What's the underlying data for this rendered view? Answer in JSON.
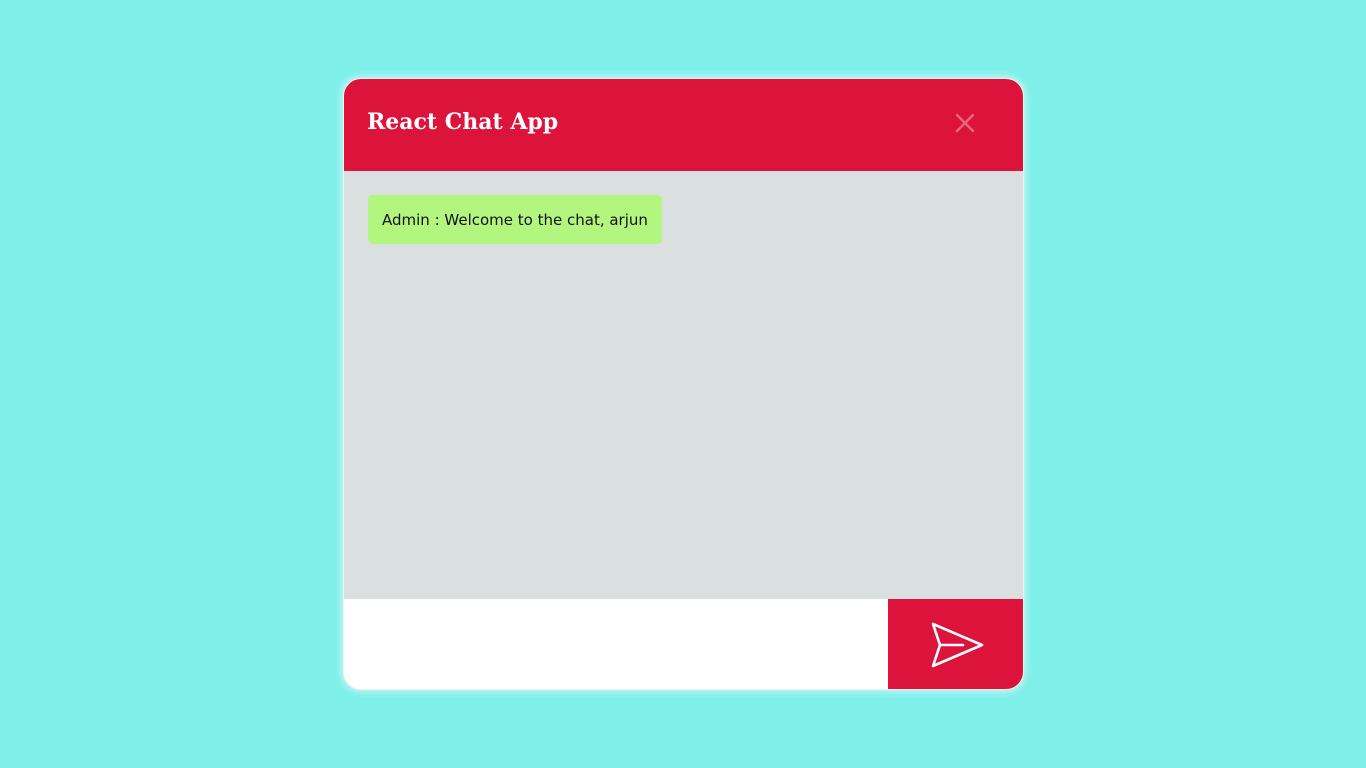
{
  "app": {
    "title": "React Chat App"
  },
  "header": {
    "close_icon": "close-icon"
  },
  "messages": [
    {
      "sender": "Admin",
      "separator": " : ",
      "text": "Welcome to the chat, arjun"
    }
  ],
  "footer": {
    "input_value": "",
    "input_placeholder": "",
    "send_icon": "paper-plane-icon"
  },
  "colors": {
    "page_background": "#7eefe9",
    "header_background": "#dc143c",
    "chat_background": "#dadfe0",
    "message_bubble": "#b3f67f",
    "send_button": "#dc143c"
  }
}
